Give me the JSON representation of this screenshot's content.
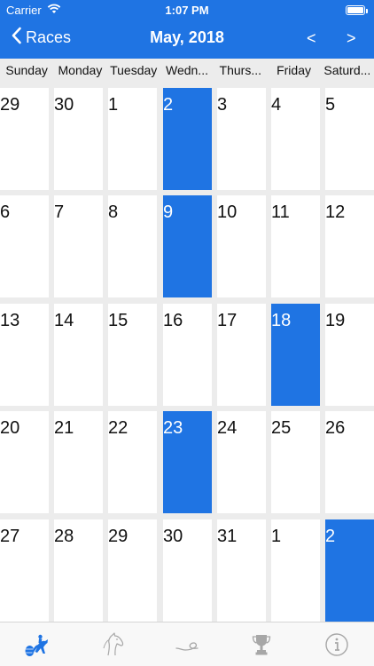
{
  "status_bar": {
    "carrier": "Carrier",
    "time": "1:07 PM"
  },
  "nav": {
    "back_label": "Races",
    "title": "May, 2018",
    "prev_label": "<",
    "next_label": ">"
  },
  "weekdays": [
    "Sunday",
    "Monday",
    "Tuesday",
    "Wedn...",
    "Thurs...",
    "Friday",
    "Saturd..."
  ],
  "calendar": {
    "weeks": [
      [
        "29",
        "30",
        "1",
        "2",
        "3",
        "4",
        "5"
      ],
      [
        "6",
        "7",
        "8",
        "9",
        "10",
        "11",
        "12"
      ],
      [
        "13",
        "14",
        "15",
        "16",
        "17",
        "18",
        "19"
      ],
      [
        "20",
        "21",
        "22",
        "23",
        "24",
        "25",
        "26"
      ],
      [
        "27",
        "28",
        "29",
        "30",
        "31",
        "1",
        "2"
      ]
    ],
    "highlighted": [
      [
        0,
        3
      ],
      [
        1,
        3
      ],
      [
        2,
        5
      ],
      [
        3,
        3
      ],
      [
        4,
        6
      ]
    ]
  },
  "tabs": [
    {
      "icon": "barrel-racer-icon",
      "active": true
    },
    {
      "icon": "horse-head-icon",
      "active": false
    },
    {
      "icon": "rope-icon",
      "active": false
    },
    {
      "icon": "trophy-icon",
      "active": false
    },
    {
      "icon": "info-icon",
      "active": false
    }
  ],
  "colors": {
    "accent": "#1f74e3",
    "tab_inactive": "#a7a7a7",
    "grid_background": "#ececec"
  }
}
